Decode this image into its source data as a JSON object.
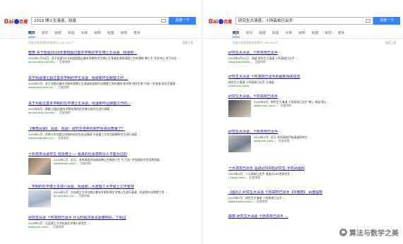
{
  "left": {
    "logo": {
      "bai": "Bai",
      "du": "百度"
    },
    "query": "2019 博士生清退，劝退",
    "search_button": "百度一下",
    "tabs": [
      "网页",
      "资讯",
      "贴吧",
      "知道",
      "文库",
      "视频",
      "地图",
      "采购",
      "更多"
    ],
    "result_info": "百度为您找到相关结果约3,280,000个",
    "tools": "搜索工具",
    "results": [
      {
        "title": "教育 关于劝退2019年度校超过基本学制的学生博士生清退 , 劝退和...",
        "text": "2019年1月30日 - 关于劝退2019年度校超过基本学制的学生博士生清退劝退和清理工作的通知 博士生 学位中心 对于毕业 ...",
        "url": "gs.xxx.edu.cn/info/...",
        "snap": "百度快照"
      },
      {
        "title": "关于劝退博士超过基本学制的学生清退 , 劝退和毕业期望工作 ...",
        "text": "2019年3月 - 关于对超过基本学制年限博士生清退劝退和毕业期望工作的通知 各学院 研究生院 为进一步加强 研究生管理 ...",
        "url": "www.xxxx.edu.cn/...",
        "snap": "百度快照"
      },
      {
        "title": "关于对超过基本学制的在学博士生清退、劝退和毕业期望工作的...",
        "text": "2019年6月 - 根据 对超过基本学制年限的在学博士研究生进行清理 ...",
        "url": "gs.xxx.edu.cn/info/...",
        "snap": "百度快照"
      },
      {
        "title": "【推荐阅读】 清退、劝退！研究生培养机制开始强调质量了？",
        "text": "2019年1月 - 西南大学对超过学制的研究生启动清退 大连理工大学对超期研究生进行清退 ...",
        "url": "www.thepaper.cn/...",
        "snap": "百度快照"
      },
      {
        "title": "十所高校清退学生 包括博士 — 我来的社会感到令人不能为过的",
        "text": "2019年1月 - 近日，多所高校开始清退博士生和硕士生 为了进一步加强研究生培养质量 ...",
        "url": "www.xxxx.com/...",
        "snap": "百度快照"
      },
      {
        "title": "...学制的在学博士生进行清退、劝退和...大连理工大学硕士工作安排",
        "text": "2019年1月 - 大连理工大学对超过基本学制年限在学博士生进行清退、劝退和毕业期望工作 ...",
        "url": "gs.xxx.edu.cn/...",
        "snap": "百度快照"
      },
      {
        "title": "研究生清退 十所高校已出手 什么时候才能清退博特别，了看园",
        "text": "2019年1月 - 大连理工大学劝退在学博士研究生 ...",
        "url": "www.xxx.com/...",
        "snap": "百度快照"
      }
    ]
  },
  "right": {
    "logo": {
      "bai": "Bai",
      "du": "百度"
    },
    "query": "研究生大清退，十所高校已出手",
    "search_button": "百度一下",
    "tabs": [
      "网页",
      "资讯",
      "贴吧",
      "知道",
      "文库",
      "视频",
      "地图",
      "采购",
      "更多"
    ],
    "result_info": "百度为您找到相关结果约1,650,000个",
    "tools": "搜索工具",
    "results": [
      {
        "title": "研究生大清退，十所高校已出手",
        "text": "2019年3月22日 - 清退 研究生大清退 十所高校已出手 ...",
        "url": "www.xxxx.com/...",
        "snap": "百度快照"
      },
      {
        "title": "研究生大清退 十所高校已出手的最新相关信息",
        "text": "研究生大清退 十所高校已出手 大清退 ...",
        "url": "news.xxx.com/...",
        "snap": ""
      },
      {
        "title": "研究生大清退，十所高校已出手",
        "text": "2019年3月 - 研究生大清退 十所高校已出手 博士 清退 硕士 ...",
        "url": "www.xxxx.com/...",
        "snap": "百度快照"
      },
      {
        "title": "研究生大清退，十所高校已出手",
        "text": "2019年3月 - 近日 多所高校开始清退研究生 ...",
        "url": "www.xxx.com/...",
        "snap": "百度快照"
      },
      {
        "title": "十大高校已出手 清退近500名研究生 手机凤凰网",
        "text": "2019年3月 - 十大高校已出手 清退近500名研究生 ...",
        "url": "i.ifeng.com/...",
        "snap": "百度快照"
      },
      {
        "title": "【图片】研究生大清退 十所高校已出手【中南吧】 百度贴吧",
        "text": "2019年3月 - 研究生大清退 十所高校已出手 ...",
        "url": "tieba.baidu.com/...",
        "snap": "百度快照"
      },
      {
        "title": "震撼 研究生大清退 十所高校已出手 ...",
        "text": "",
        "url": "",
        "snap": ""
      }
    ]
  },
  "watermark": {
    "text": "算法与数学之美",
    "icon": "wechat-icon"
  },
  "colors": {
    "link": "#1a0dab",
    "highlight": "#cc0000",
    "url": "#008000",
    "accent": "#3385ff",
    "logo_red": "#e10601",
    "logo_blue": "#2932e1"
  }
}
